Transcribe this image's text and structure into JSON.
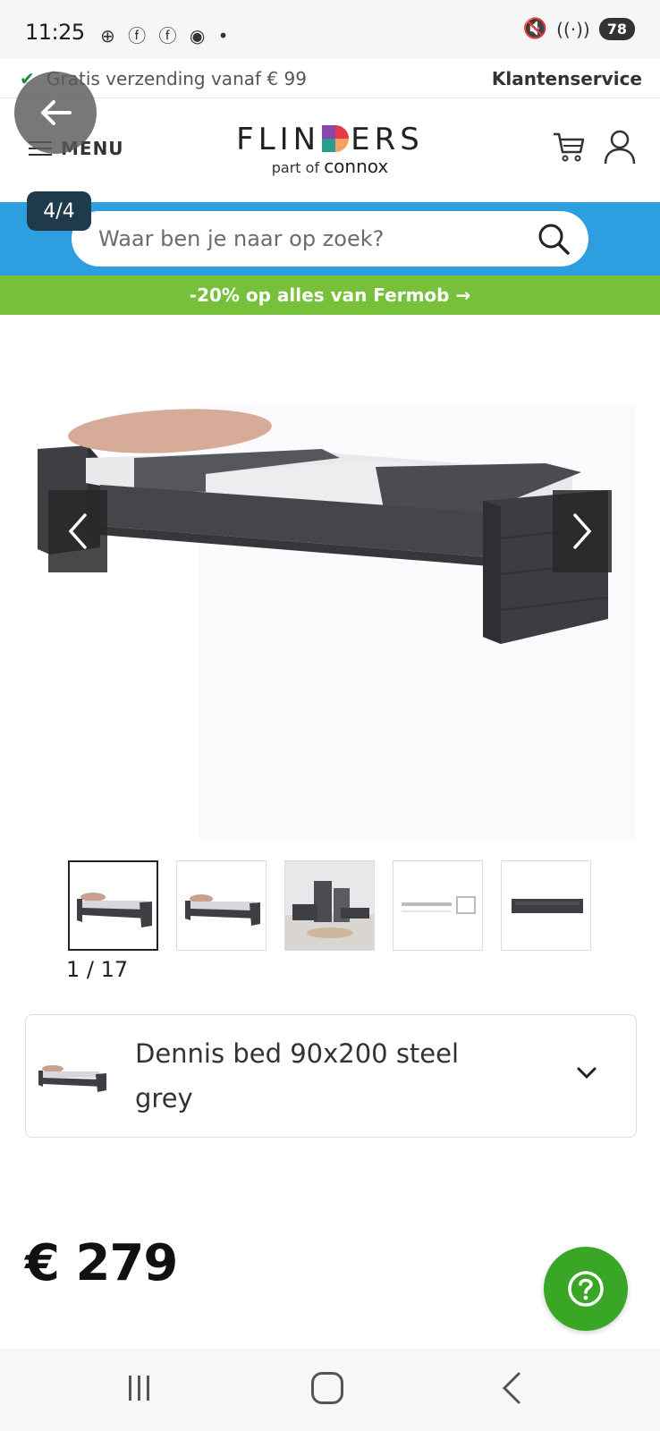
{
  "status": {
    "time": "11:25",
    "notif_icons": "⊕ ⓕ ⓕ ◉ •",
    "battery": "78",
    "signal": "5"
  },
  "promo": {
    "shipping": "Gratis verzending vanaf € 99",
    "service": "Klantenservice"
  },
  "header": {
    "menu_label": "MENU",
    "logo_left": "FLIN",
    "logo_right": "ERS",
    "logo_sub_prefix": "part of",
    "logo_sub_brand": "connox"
  },
  "gallery_counter": "4/4",
  "search": {
    "placeholder": "Waar ben je naar op zoek?"
  },
  "banner": {
    "text": "-20% op alles van Fermob →"
  },
  "product": {
    "image_count": "1 / 17",
    "variant_name": "Dennis bed 90x200 steel grey",
    "price": "€ 279"
  },
  "colors": {
    "search_blue": "#2d9fe0",
    "banner_green": "#77c13a",
    "help_green": "#3aa625",
    "bed_grey": "#3d3f44"
  },
  "icons": [
    "back-arrow-icon",
    "hamburger-icon",
    "cart-icon",
    "user-icon",
    "search-icon",
    "chevron-left-icon",
    "chevron-right-icon",
    "chevron-down-icon",
    "help-icon"
  ]
}
